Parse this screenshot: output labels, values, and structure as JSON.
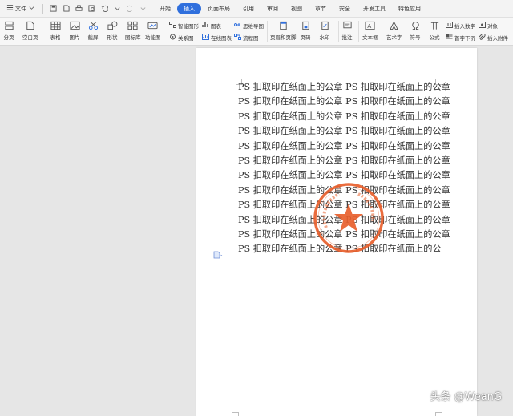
{
  "menubar": {
    "file_label": "文件",
    "tabs": [
      {
        "label": "开始",
        "active": false
      },
      {
        "label": "插入",
        "active": true
      },
      {
        "label": "页面布局",
        "active": false
      },
      {
        "label": "引用",
        "active": false
      },
      {
        "label": "审阅",
        "active": false
      },
      {
        "label": "视图",
        "active": false
      },
      {
        "label": "章节",
        "active": false
      },
      {
        "label": "安全",
        "active": false
      },
      {
        "label": "开发工具",
        "active": false
      },
      {
        "label": "特色应用",
        "active": false
      }
    ]
  },
  "ribbon": {
    "pagebreak": "分页",
    "blankpage": "空白页",
    "table": "表格",
    "picture": "图片",
    "screenshot": "截屏",
    "shape": "形状",
    "iconlib": "图标库",
    "funcchart": "功能图",
    "smartart": "智能图形",
    "relation": "关系图",
    "chart": "图表",
    "onlinechart": "在线图表",
    "mindmap": "思维导图",
    "flowchart": "流程图",
    "headerfooter": "页眉和页脚",
    "pagenum": "页码",
    "watermark": "水印",
    "comment": "批注",
    "textbox": "文本框",
    "wordart": "艺术字",
    "symbol": "符号",
    "formula": "公式",
    "insertnumber": "插入数字",
    "dropcap": "首字下沉",
    "object": "对象",
    "attachment": "插入附件"
  },
  "document": {
    "lines": [
      "PS 扣取印在纸面上的公章 PS 扣取印在纸面上的公章",
      "PS 扣取印在纸面上的公章 PS 扣取印在纸面上的公章",
      "PS 扣取印在纸面上的公章 PS 扣取印在纸面上的公章",
      "PS 扣取印在纸面上的公章 PS 扣取印在纸面上的公章",
      "PS 扣取印在纸面上的公章 PS 扣取印在纸面上的公章",
      "PS 扣取印在纸面上的公章 PS 扣取印在纸面上的公章",
      "PS 扣取印在纸面上的公章 PS 扣取印在纸面上的公章",
      "PS 扣取印在纸面上的公章 PS 扣取印在纸面上的公章",
      "PS 扣取印在纸面上的公章 PS 扣取印在纸面上的公章",
      "PS 扣取印在纸面上的公章 PS 扣取印在纸面上的公章",
      "PS 扣取印在纸面上的公章 PS 扣取印在纸面上的公章",
      "PS 扣取印在纸面上的公章 PS 扣取印在纸面上的公"
    ],
    "stamp_color": "#e8602c"
  },
  "watermark": {
    "text": "头条 @WeanG"
  },
  "colors": {
    "accent": "#2f6fdd"
  }
}
